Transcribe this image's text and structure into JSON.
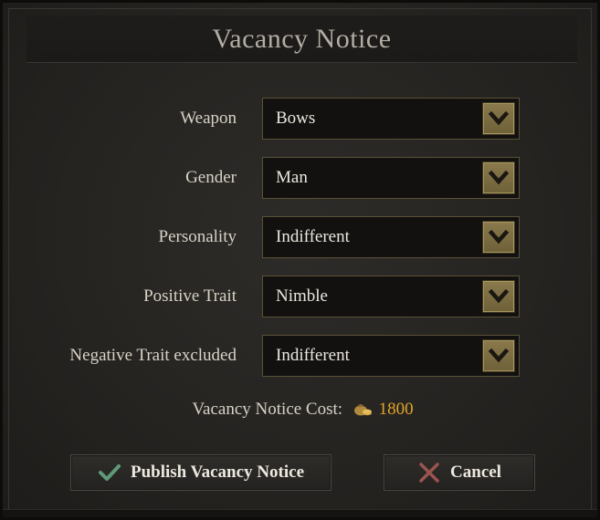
{
  "dialog": {
    "title": "Vacancy Notice"
  },
  "fields": [
    {
      "label": "Weapon",
      "value": "Bows"
    },
    {
      "label": "Gender",
      "value": "Man"
    },
    {
      "label": "Personality",
      "value": "Indifferent"
    },
    {
      "label": "Positive Trait",
      "value": "Nimble"
    },
    {
      "label": "Negative Trait excluded",
      "value": "Indifferent"
    }
  ],
  "cost": {
    "label": "Vacancy Notice Cost:",
    "icon": "coin-pouch-icon",
    "value": "1800",
    "value_color": "#e0a32a"
  },
  "buttons": {
    "publish_label": "Publish Vacancy Notice",
    "publish_icon": "checkmark-icon",
    "cancel_label": "Cancel",
    "cancel_icon": "x-cross-icon"
  },
  "colors": {
    "accent_gold": "#7d6e43",
    "check_green": "#5f9a78",
    "cross_red": "#9a5450"
  }
}
